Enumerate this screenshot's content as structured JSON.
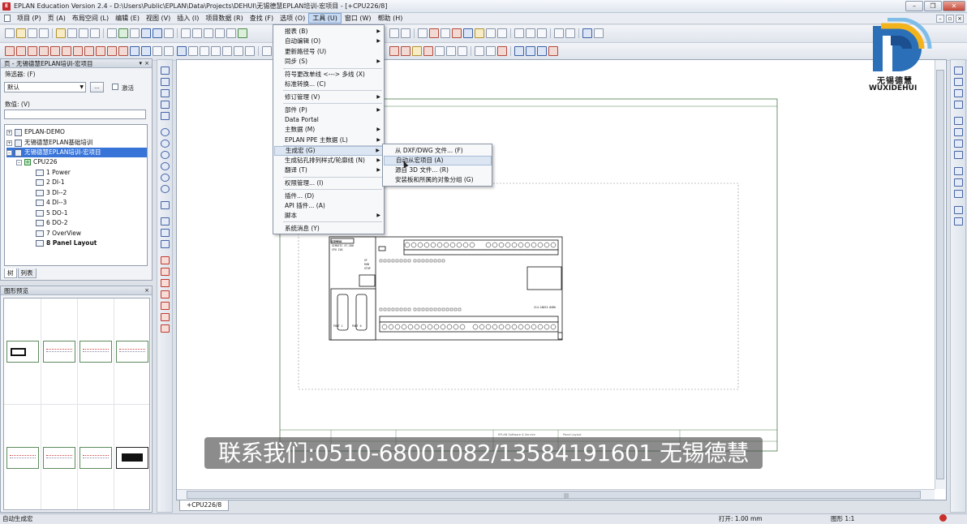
{
  "window": {
    "title": "EPLAN Education Version 2.4 - D:\\Users\\Public\\EPLAN\\Data\\Projects\\DEHUI\\无锡德慧EPLAN培训-宏项目 - [+CPU226/8]",
    "app_icon": "eplan-logo-icon"
  },
  "menubar": {
    "items": [
      "项目 (P)",
      "页 (A)",
      "布局空间 (L)",
      "编辑 (E)",
      "视图 (V)",
      "插入 (I)",
      "项目数据 (R)",
      "查找 (F)",
      "选项 (O)",
      "工具 (U)",
      "窗口 (W)",
      "帮助 (H)"
    ],
    "active": "工具 (U)"
  },
  "tools_menu": {
    "items": [
      {
        "label": "报表 (B)",
        "submenu": true
      },
      {
        "label": "自动编辑 (O)",
        "submenu": true
      },
      {
        "label": "更新路径号 (U)",
        "submenu": false
      },
      {
        "label": "同步 (S)",
        "submenu": true
      },
      {
        "label": "符号更改单线 <---> 多线 (X)",
        "submenu": false
      },
      {
        "label": "标准转换... (C)",
        "submenu": false
      },
      {
        "label": "修订管理 (V)",
        "submenu": true
      },
      {
        "label": "部件 (P)",
        "submenu": true
      },
      {
        "label": "Data Portal",
        "submenu": false
      },
      {
        "label": "主数据 (M)",
        "submenu": true
      },
      {
        "label": "EPLAN PPE 主数据 (L)",
        "submenu": true
      },
      {
        "label": "生成宏 (G)",
        "submenu": true,
        "highlighted": true
      },
      {
        "label": "生成钻孔排列样式/轮廓线 (N)",
        "submenu": true
      },
      {
        "label": "翻译 (T)",
        "submenu": true
      },
      {
        "label": "权限管理... (I)",
        "submenu": false
      },
      {
        "label": "插件... (D)",
        "submenu": false
      },
      {
        "label": "API 插件... (A)",
        "submenu": false
      },
      {
        "label": "脚本",
        "submenu": true
      },
      {
        "label": "系统消息 (Y)",
        "submenu": false
      }
    ]
  },
  "generate_macro_submenu": {
    "items": [
      {
        "label": "从 DXF/DWG 文件... (F)"
      },
      {
        "label": "自动从宏项目 (A)",
        "highlighted": true
      },
      {
        "label": "源自 3D 文件... (R)"
      },
      {
        "label": "安装板和所属的对象分组 (G)"
      }
    ]
  },
  "page_navigator": {
    "title": "页 - 无锡德慧EPLAN培训-宏项目",
    "filter_label": "筛选器: (F)",
    "filter_value": "默认",
    "filter_button": "...",
    "activate_label": "激活",
    "value_label": "数值: (V)",
    "tree": [
      {
        "label": "EPLAN-DEMO",
        "level": 0,
        "type": "project"
      },
      {
        "label": "无锡德慧EPLAN基础培训",
        "level": 0,
        "type": "project"
      },
      {
        "label": "无锡德慧EPLAN培训-宏项目",
        "level": 0,
        "type": "project",
        "selected": true
      },
      {
        "label": "CPU226",
        "level": 1,
        "type": "structure"
      },
      {
        "label": "1 Power",
        "level": 2,
        "type": "page"
      },
      {
        "label": "2 DI-1",
        "level": 2,
        "type": "page"
      },
      {
        "label": "3 DI--2",
        "level": 2,
        "type": "page"
      },
      {
        "label": "4 DI--3",
        "level": 2,
        "type": "page"
      },
      {
        "label": "5 DO-1",
        "level": 2,
        "type": "page"
      },
      {
        "label": "6 DO-2",
        "level": 2,
        "type": "page"
      },
      {
        "label": "7 OverView",
        "level": 2,
        "type": "page"
      },
      {
        "label": "8 Panel Layout",
        "level": 2,
        "type": "page",
        "bold": true
      }
    ],
    "tabs": [
      "树",
      "列表"
    ]
  },
  "graphic_preview": {
    "title": "图形预览"
  },
  "drawing": {
    "plc_brand": "SIEMENS",
    "plc_model": "SIMATIC S7-200",
    "plc_order": "CPU 226",
    "plc_part_no": "214-2AD23-0XB0",
    "status_labels": [
      "SF",
      "RUN",
      "STOP"
    ],
    "port_labels": [
      "PORT 1",
      "PORT 0"
    ],
    "title_block": [
      "EPLAN Software & Service",
      "Panel Layout"
    ]
  },
  "document_tab": "+CPU226/8",
  "logo": {
    "cn": "无锡德慧",
    "en": "WUXIDEHUI"
  },
  "subtitle": "联系我们:0510-68001082/13584191601 无锡德慧",
  "statusbar": {
    "left": "自动生成宏",
    "grid": "打开: 1.00 mm",
    "scale": "图形 1:1"
  },
  "colors": {
    "accent": "#3874d8",
    "menu_highlight": "#dce6f3",
    "status_error": "#c9302c"
  }
}
